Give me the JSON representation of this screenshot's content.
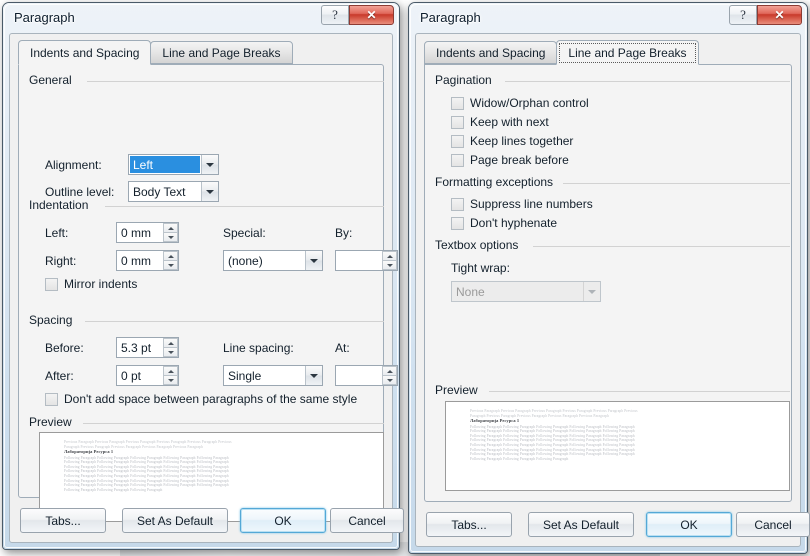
{
  "window_left": {
    "title": "Paragraph",
    "help_glyph": "?",
    "close_glyph": "✕",
    "tabs": [
      {
        "label": "Indents and Spacing",
        "active": true
      },
      {
        "label": "Line and Page Breaks",
        "active": false
      }
    ],
    "general": {
      "group_label": "General",
      "alignment_label": "Alignment:",
      "alignment_value": "Left",
      "outline_label": "Outline level:",
      "outline_value": "Body Text"
    },
    "indentation": {
      "group_label": "Indentation",
      "left_label": "Left:",
      "left_value": "0 mm",
      "right_label": "Right:",
      "right_value": "0 mm",
      "special_label": "Special:",
      "special_value": "(none)",
      "by_label": "By:",
      "by_value": "",
      "mirror_label": "Mirror indents",
      "mirror_checked": false
    },
    "spacing": {
      "group_label": "Spacing",
      "before_label": "Before:",
      "before_value": "5.3 pt",
      "after_label": "After:",
      "after_value": "0 pt",
      "line_spacing_label": "Line spacing:",
      "line_spacing_value": "Single",
      "at_label": "At:",
      "at_value": "",
      "dont_add_label": "Don't add space between paragraphs of the same style",
      "dont_add_checked": false
    },
    "preview": {
      "group_label": "Preview",
      "prev_text": "Previous Paragraph Previous Paragraph Previous Paragraph Previous Paragraph Previous Paragraph Previous",
      "prev_text2": "Paragraph Previous Paragraph Previous Paragraph Previous Paragraph Previous Paragraph",
      "sample_title": "Лабораторија Ресурса 1",
      "follow_text": "Following Paragraph Following Paragraph Following Paragraph Following Paragraph Following Paragraph",
      "follow_last": "Following Paragraph Following Paragraph Following Paragraph",
      "follow_count": 7
    },
    "buttons": {
      "tabs": "Tabs...",
      "set_default": "Set As Default",
      "ok": "OK",
      "cancel": "Cancel"
    }
  },
  "window_right": {
    "title": "Paragraph",
    "help_glyph": "?",
    "close_glyph": "✕",
    "tabs": [
      {
        "label": "Indents and Spacing",
        "active": false
      },
      {
        "label": "Line and Page Breaks",
        "active": true
      }
    ],
    "pagination": {
      "group_label": "Pagination",
      "items": [
        {
          "label": "Widow/Orphan control",
          "checked": false
        },
        {
          "label": "Keep with next",
          "checked": false
        },
        {
          "label": "Keep lines together",
          "checked": false
        },
        {
          "label": "Page break before",
          "checked": false
        }
      ]
    },
    "formatting_exceptions": {
      "group_label": "Formatting exceptions",
      "items": [
        {
          "label": "Suppress line numbers",
          "checked": false
        },
        {
          "label": "Don't hyphenate",
          "checked": false
        }
      ]
    },
    "textbox_options": {
      "group_label": "Textbox options",
      "tight_wrap_label": "Tight wrap:",
      "tight_wrap_value": "None",
      "disabled": true
    },
    "preview": {
      "group_label": "Preview",
      "prev_text": "Previous Paragraph Previous Paragraph Previous Paragraph Previous Paragraph Previous Paragraph Previous",
      "prev_text2": "Paragraph Previous Paragraph Previous Paragraph Previous Paragraph Previous Paragraph",
      "sample_title": "Лабораторија Ресурса 1",
      "follow_text": "Following Paragraph Following Paragraph Following Paragraph Following Paragraph Following Paragraph",
      "follow_last": "Following Paragraph Following Paragraph Following Paragraph",
      "follow_count": 7
    },
    "buttons": {
      "tabs": "Tabs...",
      "set_default": "Set As Default",
      "ok": "OK",
      "cancel": "Cancel"
    }
  },
  "colors": {
    "accent": "#2a8fe0",
    "close_red": "#c8392a",
    "focus_blue": "#54a8d6"
  }
}
